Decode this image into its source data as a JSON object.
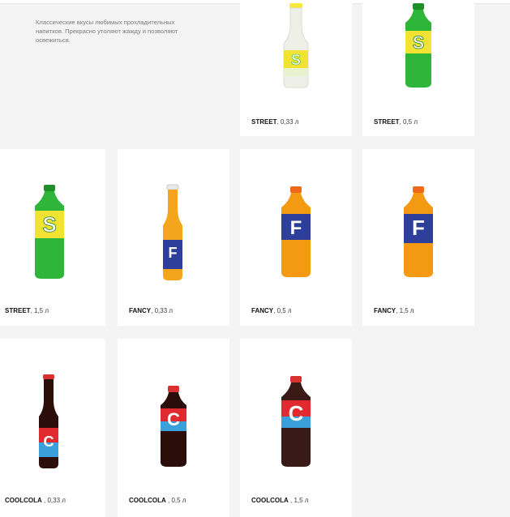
{
  "description": "Классические вкусы любимых прохладительных напитков. Прекрасно утоляют жажду и позволяют освежиться.",
  "products": [
    {
      "brand": "STREET",
      "size": ", 0,33 л",
      "label_letter": "S",
      "label_text": "STREET",
      "flavor": "street-glass"
    },
    {
      "brand": "STREET",
      "size": ", 0,5 л",
      "label_letter": "S",
      "label_text": "STREET",
      "flavor": "street-pet"
    },
    {
      "brand": "STREET",
      "size": ", 1,5 л",
      "label_letter": "S",
      "label_text": "STREET",
      "flavor": "street-pet"
    },
    {
      "brand": "FANCY",
      "size": ", 0,33 л",
      "label_letter": "F",
      "label_text": "FANCY",
      "flavor": "fancy-glass"
    },
    {
      "brand": "FANCY",
      "size": ", 0,5 л",
      "label_letter": "F",
      "label_text": "FANCY",
      "flavor": "fancy-pet"
    },
    {
      "brand": "FANCY",
      "size": ", 1,5 л",
      "label_letter": "F",
      "label_text": "FANCY",
      "flavor": "fancy-pet"
    },
    {
      "brand": "COOLCOLA",
      "size": " , 0,33 л",
      "label_letter": "C",
      "label_text": "COOLCOLA",
      "flavor": "cola-glass"
    },
    {
      "brand": "COOLCOLA",
      "size": " , 0,5 л",
      "label_letter": "C",
      "label_text": "COOLCOLA",
      "flavor": "cola-pet"
    },
    {
      "brand": "COOLCOLA",
      "size": " , 1,5 л",
      "label_letter": "C",
      "label_text": "COOLCOLA",
      "flavor": "cola-pet"
    }
  ],
  "colors": {
    "page_bg": "#f4f4f4",
    "card_bg": "#ffffff",
    "street_green": "#2fb53a",
    "street_yellow": "#f2e233",
    "fancy_orange": "#f39a12",
    "fancy_blue": "#2d3f9a",
    "cola_dark": "#2b0d0a",
    "cola_red": "#e02a2f",
    "cola_blue": "#3aa0dc"
  }
}
